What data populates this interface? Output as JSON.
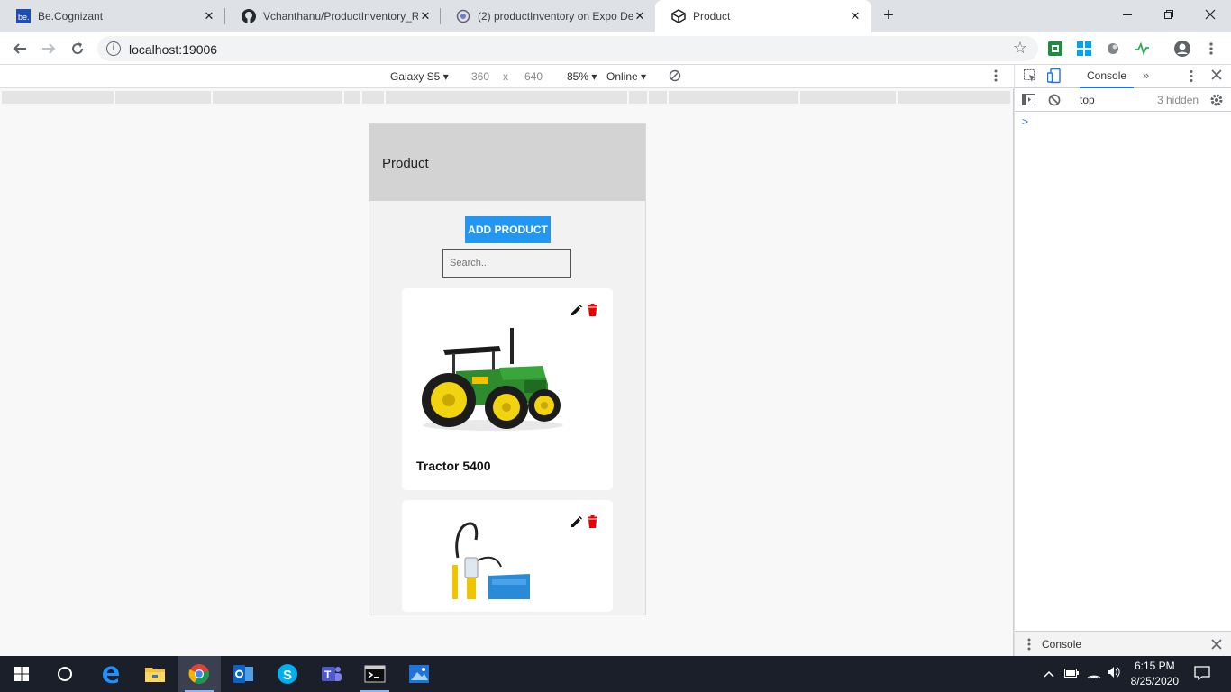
{
  "browser": {
    "tabs": [
      {
        "title": "Be.Cognizant",
        "favicon": "be-cognizant-icon",
        "active": false
      },
      {
        "title": "Vchanthanu/ProductInventory_Re",
        "favicon": "github-icon",
        "active": false
      },
      {
        "title": "(2) productInventory on Expo De",
        "favicon": "expo-icon",
        "active": false
      },
      {
        "title": "Product",
        "favicon": "expo-box-icon",
        "active": true
      }
    ],
    "url": "localhost:19006",
    "accent": "#1a73e8"
  },
  "device_toolbar": {
    "device": "Galaxy S5",
    "width": "360",
    "times": "x",
    "height": "640",
    "zoom": "85%",
    "throttle": "Online"
  },
  "app": {
    "header_title": "Product",
    "add_button_label": "ADD PRODUCT",
    "search_placeholder": "Search..",
    "button_color": "#2196f3",
    "products": [
      {
        "name": "Tractor 5400",
        "image": "tractor-image"
      },
      {
        "name": "",
        "image": "sprayer-image"
      }
    ]
  },
  "devtools": {
    "tab": "Console",
    "more_tabs": "»",
    "context": "top",
    "hidden_count": "3 hidden",
    "prompt": ">",
    "drawer_tab": "Console"
  },
  "taskbar": {
    "time": "6:15 PM",
    "date": "8/25/2020"
  }
}
